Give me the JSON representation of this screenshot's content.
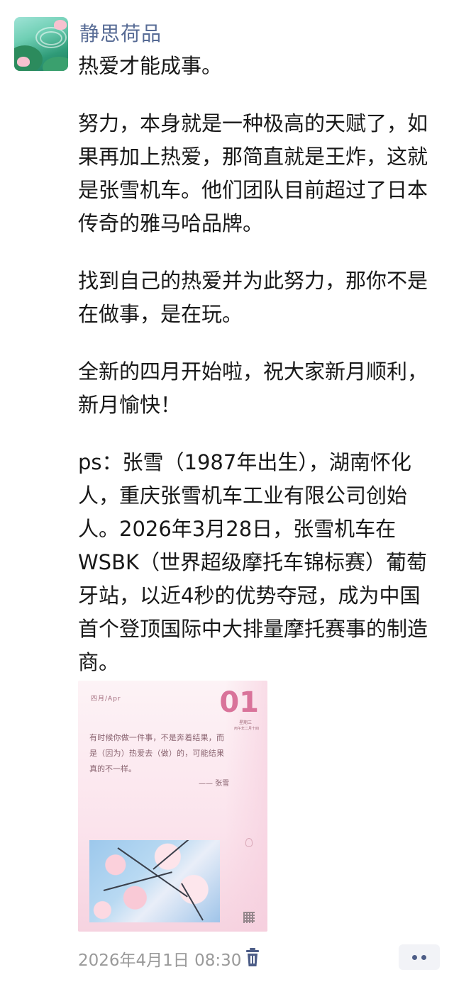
{
  "post": {
    "author": "静思荷品",
    "paragraphs": [
      "热爱才能成事。",
      "努力，本身就是一种极高的天赋了，如果再加上热爱，那简直就是王炸，这就是张雪机车。他们团队目前超过了日本传奇的雅马哈品牌。",
      "找到自己的热爱并为此努力，那你不是在做事，是在玩。",
      "全新的四月开始啦，祝大家新月顺利，新月愉快！",
      "ps：张雪（1987年出生），湖南怀化人，重庆张雪机车工业有限公司创始人。2026年3月28日，张雪机车在WSBK（世界超级摩托车锦标赛）葡萄牙站，以近4秒的优势夺冠，成为中国首个登顶国际中大排量摩托赛事的制造商。"
    ],
    "image": {
      "month_label": "四月/Apr",
      "day": "01",
      "weekday": "星期三",
      "lunar": "丙午年二月十四",
      "quote": "有时候你做一件事，不是奔着结果，而是（因为）热爱去（做）的，可能结果真的不一样。",
      "signature": "—— 张雪"
    },
    "timestamp": "2026年4月1日 08:30"
  },
  "icons": {
    "delete": "trash-icon",
    "more": "more-dots-icon"
  },
  "colors": {
    "author": "#576b95",
    "text": "#181818",
    "meta": "#9a9a9a",
    "more_bg": "#f2f3f7",
    "more_dot": "#4d5d87"
  }
}
